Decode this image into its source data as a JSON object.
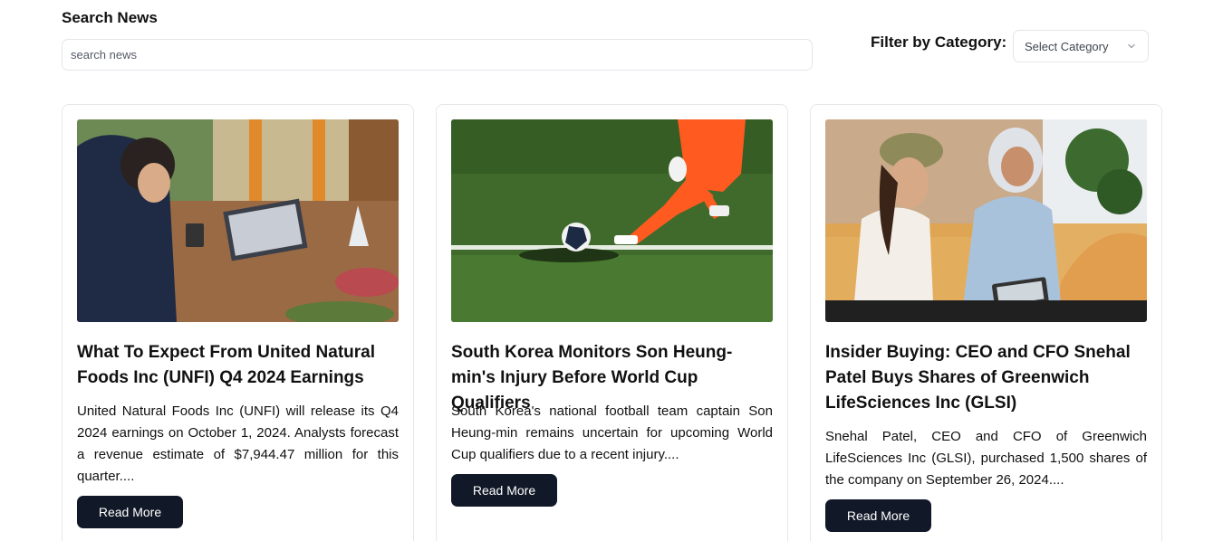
{
  "search": {
    "label": "Search News",
    "placeholder": "search news",
    "value": ""
  },
  "filter": {
    "label": "Filter by Category:",
    "selected": "Select Category"
  },
  "articles": [
    {
      "title": "What To Expect From United Natural Foods Inc (UNFI) Q4 2024 Earnings",
      "summary": "United Natural Foods Inc (UNFI) will release its Q4 2024 earnings on October 1, 2024. Analysts forecast a revenue estimate of $7,944.47 million for this quarter....",
      "button": "Read More",
      "image": "woman-using-tablet-photo"
    },
    {
      "title": "South Korea Monitors Son Heung-min's Injury Before World Cup Qualifiers",
      "summary": "South Korea's national football team captain Son Heung-min remains uncertain for upcoming World Cup qualifiers due to a recent injury....",
      "button": "Read More",
      "image": "football-player-kicking-ball-photo"
    },
    {
      "title": "Insider Buying: CEO and CFO Snehal Patel Buys Shares of Greenwich LifeSciences Inc (GLSI)",
      "summary": "Snehal Patel, CEO and CFO of Greenwich LifeSciences Inc (GLSI), purchased 1,500 shares of the company on September 26, 2024....",
      "button": "Read More",
      "image": "two-women-meeting-photo"
    }
  ],
  "colors": {
    "button_bg": "#111827",
    "border": "#e5e7eb"
  }
}
